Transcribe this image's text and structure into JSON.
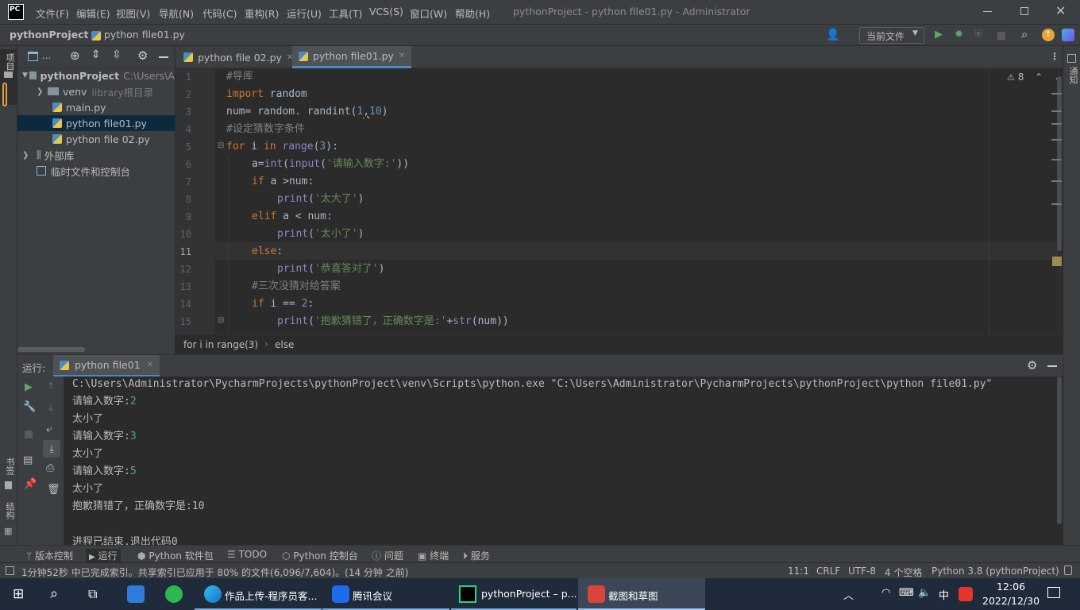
{
  "titlebar": {
    "logo": "PC",
    "menu": [
      "文件(F)",
      "编辑(E)",
      "视图(V)",
      "导航(N)",
      "代码(C)",
      "重构(R)",
      "运行(U)",
      "工具(T)",
      "VCS(S)",
      "窗口(W)",
      "帮助(H)"
    ],
    "title": "pythonProject - python file01.py - Administrator"
  },
  "navbar": {
    "project": "pythonProject",
    "file": "python file01.py",
    "run_config": "当前文件"
  },
  "left_strip": {
    "project_label": "项目",
    "bookmarks_label": "书签",
    "structure_label": "结构"
  },
  "right_strip": {
    "notifications_label": "通知"
  },
  "project_tree": {
    "root_name": "pythonProject",
    "root_path": "C:\\Users\\A",
    "venv": "venv",
    "venv_hint": "library根目录",
    "files": [
      "main.py",
      "python file01.py",
      "python file 02.py"
    ],
    "external": "外部库",
    "scratches": "临时文件和控制台"
  },
  "tabs": [
    "python file 02.py",
    "python file01.py"
  ],
  "editor": {
    "warnings": "8",
    "line_numbers": [
      "1",
      "2",
      "3",
      "4",
      "5",
      "6",
      "7",
      "8",
      "9",
      "10",
      "11",
      "12",
      "13",
      "14",
      "15"
    ],
    "lines": {
      "l1": "#导库",
      "l2_kw": "import",
      "l2_rest": " random",
      "l3_a": "num= random. randint(",
      "l3_n1": "1",
      "l3_c": ",",
      "l3_n2": "10",
      "l3_b": ")",
      "l4": "#设定猜数字条件",
      "l5_for": "for",
      "l5_a": " i ",
      "l5_in": "in",
      "l5_sp": " ",
      "l5_range": "range",
      "l5_p": "(",
      "l5_n": "3",
      "l5_e": "):",
      "l6_a": "a=",
      "l6_int": "int",
      "l6_p": "(",
      "l6_input": "input",
      "l6_q": "(",
      "l6_s": "'请输入数字:'",
      "l6_e": "))",
      "l7_if": "if",
      "l7_rest": " a >num:",
      "l8_print": "print",
      "l8_p": "(",
      "l8_s": "'太大了'",
      "l8_e": ")",
      "l9_elif": "elif",
      "l9_rest": " a < num:",
      "l10_print": "print",
      "l10_p": "(",
      "l10_s": "'太小了'",
      "l10_e": ")",
      "l11_else": "else",
      "l11_e": ":",
      "l12_print": "print",
      "l12_p": "(",
      "l12_s": "'恭喜答对了'",
      "l12_e": ")",
      "l13": "#三次没猜对给答案",
      "l14_if": "if",
      "l14_rest": " i == ",
      "l14_n": "2",
      "l14_e": ":",
      "l15_print": "print",
      "l15_p": "(",
      "l15_s": "'抱歉猜错了，正确数字是:'",
      "l15_plus": "+",
      "l15_str": "str",
      "l15_e": "(num))"
    }
  },
  "breadcrumb": {
    "part1": "for i in range(3)",
    "sep": "›",
    "part2": "else"
  },
  "run": {
    "label": "运行:",
    "tab": "python file01",
    "console": {
      "cmd": "C:\\Users\\Administrator\\PycharmProjects\\pythonProject\\venv\\Scripts\\python.exe \"C:\\Users\\Administrator\\PycharmProjects\\pythonProject\\python file01.py\"",
      "prompt": "请输入数字:",
      "in1": "2",
      "out1": "太小了",
      "in2": "3",
      "out2": "太小了",
      "in3": "5",
      "out3": "太小了",
      "final": "抱歉猜错了，正确数字是:10",
      "exit": "进程已结束,退出代码0"
    }
  },
  "toolwindows": [
    "版本控制",
    "运行",
    "Python 软件包",
    "TODO",
    "Python 控制台",
    "问题",
    "终端",
    "服务"
  ],
  "status": {
    "message": "1分钟52秒 中已完成索引。共享索引已应用于 80% 的文件(6,096/7,604)。(14 分钟 之前)",
    "position": "11:1",
    "line_sep": "CRLF",
    "encoding": "UTF-8",
    "indent": "4 个空格",
    "interpreter": "Python 3.8 (pythonProject)"
  },
  "taskbar": {
    "app1": "作品上传-程序员客...",
    "app2": "腾讯会议",
    "app3": "pythonProject – p...",
    "app4": "截图和草图",
    "ime": "中",
    "time": "12:06",
    "date": "2022/12/30"
  },
  "colors": {
    "keyword": "#cc7832",
    "string": "#6a8759",
    "comment": "#808080",
    "number": "#6897bb",
    "builtin": "#8888c6",
    "selection": "#0d293e"
  }
}
